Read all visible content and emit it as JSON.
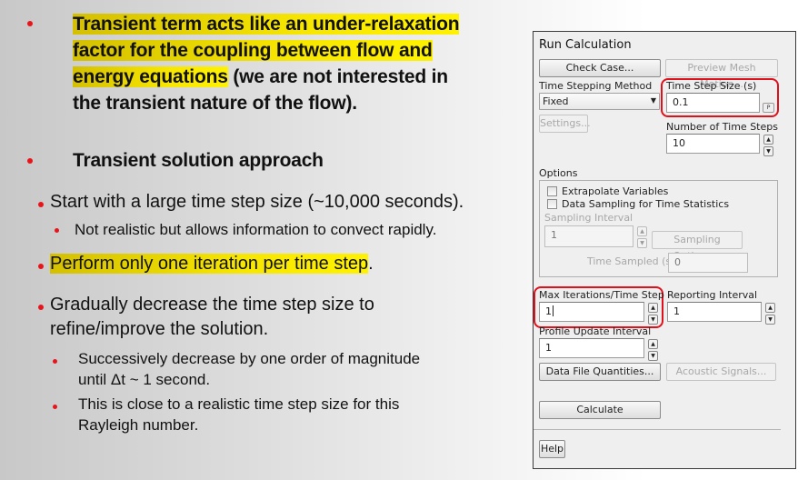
{
  "slide": {
    "bullets": [
      {
        "level": 1,
        "bold": true,
        "lines": [
          "Transient term acts like an under-relaxation",
          "factor for the coupling between flow and",
          "energy equations",
          " (we are not interested in",
          "the transient nature of the flow)."
        ],
        "highlighted": "Transient term acts like an under-relaxation factor for the coupling between flow and energy equations"
      },
      {
        "level": 1,
        "bold": true,
        "text": "Transient solution approach"
      },
      {
        "level": 2,
        "text": "Start with a large time step size (~10,000 seconds)."
      },
      {
        "level": 3,
        "text": "Not realistic but allows information to convect rapidly."
      },
      {
        "level": 2,
        "text_highlighted": "Perform only one iteration per time step",
        "text_after": "."
      },
      {
        "level": 2,
        "lines": [
          "Gradually decrease the time step size to",
          "refine/improve the solution."
        ]
      },
      {
        "level": 3,
        "lines": [
          "Successively decrease by one order of magnitude",
          "until Δt ~ 1 second."
        ]
      },
      {
        "level": 3,
        "lines": [
          "This is close to a realistic time step size for this",
          "Rayleigh number."
        ]
      }
    ],
    "bullet_color": "#e8141b",
    "highlight_color": "#f7e600"
  },
  "panel": {
    "title": "Run Calculation",
    "check_case_label": "Check Case...",
    "preview_mesh_motion_label": "Preview Mesh Motion...",
    "time_stepping_method_label": "Time Stepping Method",
    "time_stepping_method_value": "Fixed",
    "time_step_size_label": "Time Step Size (s)",
    "time_step_size_value": "0.1",
    "p_button_label": "P",
    "settings_label": "Settings...",
    "num_time_steps_label": "Number of Time Steps",
    "num_time_steps_value": "10",
    "options_label": "Options",
    "extrapolate_variables_label": "Extrapolate Variables",
    "extrapolate_variables_checked": false,
    "data_sampling_label": "Data Sampling for Time Statistics",
    "data_sampling_checked": false,
    "sampling_interval_label": "Sampling Interval",
    "sampling_interval_value": "1",
    "sampling_options_label": "Sampling Options...",
    "time_sampled_label": "Time Sampled (s)",
    "time_sampled_value": "0",
    "max_iterations_label": "Max Iterations/Time Step",
    "max_iterations_value": "1",
    "reporting_interval_label": "Reporting Interval",
    "reporting_interval_value": "1",
    "profile_update_interval_label": "Profile Update Interval",
    "profile_update_interval_value": "1",
    "data_file_quantities_label": "Data File Quantities...",
    "acoustic_signals_label": "Acoustic Signals...",
    "calculate_label": "Calculate",
    "help_label": "Help",
    "highlight_color": "#e0101c"
  }
}
